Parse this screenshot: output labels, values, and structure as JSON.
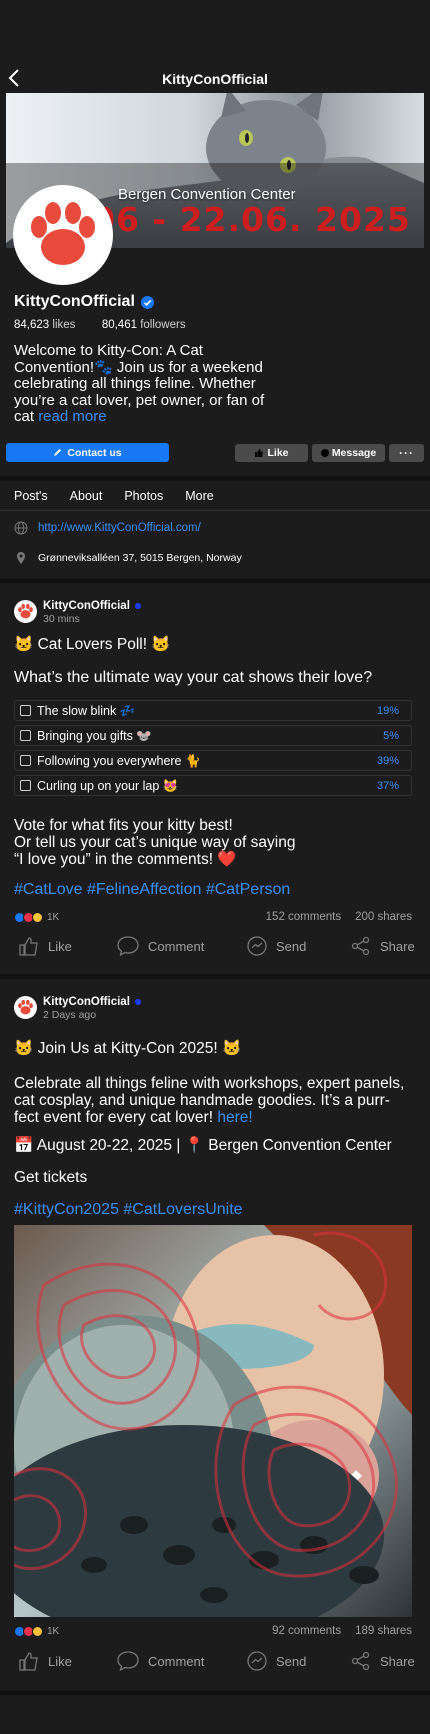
{
  "header": {
    "title": "KittyConOfficial",
    "back_icon": "chevron-left-icon"
  },
  "cover": {
    "venue": "Bergen Convention Center",
    "dates": "06 - 22.06. 2025",
    "date_color": "#cc1e1e"
  },
  "profile": {
    "name": "KittyConOfficial",
    "likes_num": "84,623",
    "likes_label": "likes",
    "followers_num": "80,461",
    "followers_label": "followers",
    "bio": "Welcome to Kitty-Con: A Cat Convention!🐾 Join us for a weekend celebrating all things feline. Whether you’re a cat lover, pet owner, or fan of cat",
    "read_more": "read more"
  },
  "buttons": {
    "contact": "Contact us",
    "like": "Like",
    "message": "Message",
    "more": "···"
  },
  "tabs": [
    "Post's",
    "About",
    "Photos",
    "More"
  ],
  "about": {
    "website": "http://www.KittyConOfficial.com/",
    "address": "Grønneviksalléen 37, 5015 Bergen, Norway"
  },
  "posts": [
    {
      "author": "KittyConOfficial",
      "time": "30 mins",
      "title": "🐱 Cat Lovers Poll! 🐱",
      "question": "What’s the ultimate way your cat shows their love?",
      "poll": [
        {
          "label": "The slow blink 💤",
          "percent": "19%"
        },
        {
          "label": "Bringing you gifts 🐭",
          "percent": "5%"
        },
        {
          "label": "Following you everywhere 🐈",
          "percent": "39%"
        },
        {
          "label": "Curling up on your lap 😻",
          "percent": "37%"
        }
      ],
      "body_line1": "Vote for what fits your kitty best!",
      "body_line2": "Or tell us your cat’s unique way of saying",
      "body_line3": "“I love you” in the comments! ❤️",
      "hashtags": "#CatLove #FelineAffection #CatPerson",
      "reactions": "1K",
      "comments": "152 comments",
      "shares": "200 shares"
    },
    {
      "author": "KittyConOfficial",
      "time": "2 Days ago",
      "title": "🐱 Join Us at Kitty-Con 2025! 🐱",
      "body": "Celebrate all things feline with workshops, expert panels, cat cosplay, and unique handmade goodies. It’s a purr-fect event for every cat lover!",
      "body_link": "here!",
      "event_line": "📅 August 20-22, 2025 | 📍 Bergen Convention Center",
      "tickets": "Get tickets",
      "hashtags": "#KittyCon2025 #CatLoversUnite",
      "reactions": "1K",
      "comments": "92 comments",
      "shares": "189 shares"
    }
  ],
  "actions": {
    "like": "Like",
    "comment": "Comment",
    "send": "Send",
    "share": "Share"
  },
  "colors": {
    "background": "#1c1c1c",
    "accent": "#1877f2",
    "link": "#3b8ef0",
    "verified": "#1877f2"
  }
}
